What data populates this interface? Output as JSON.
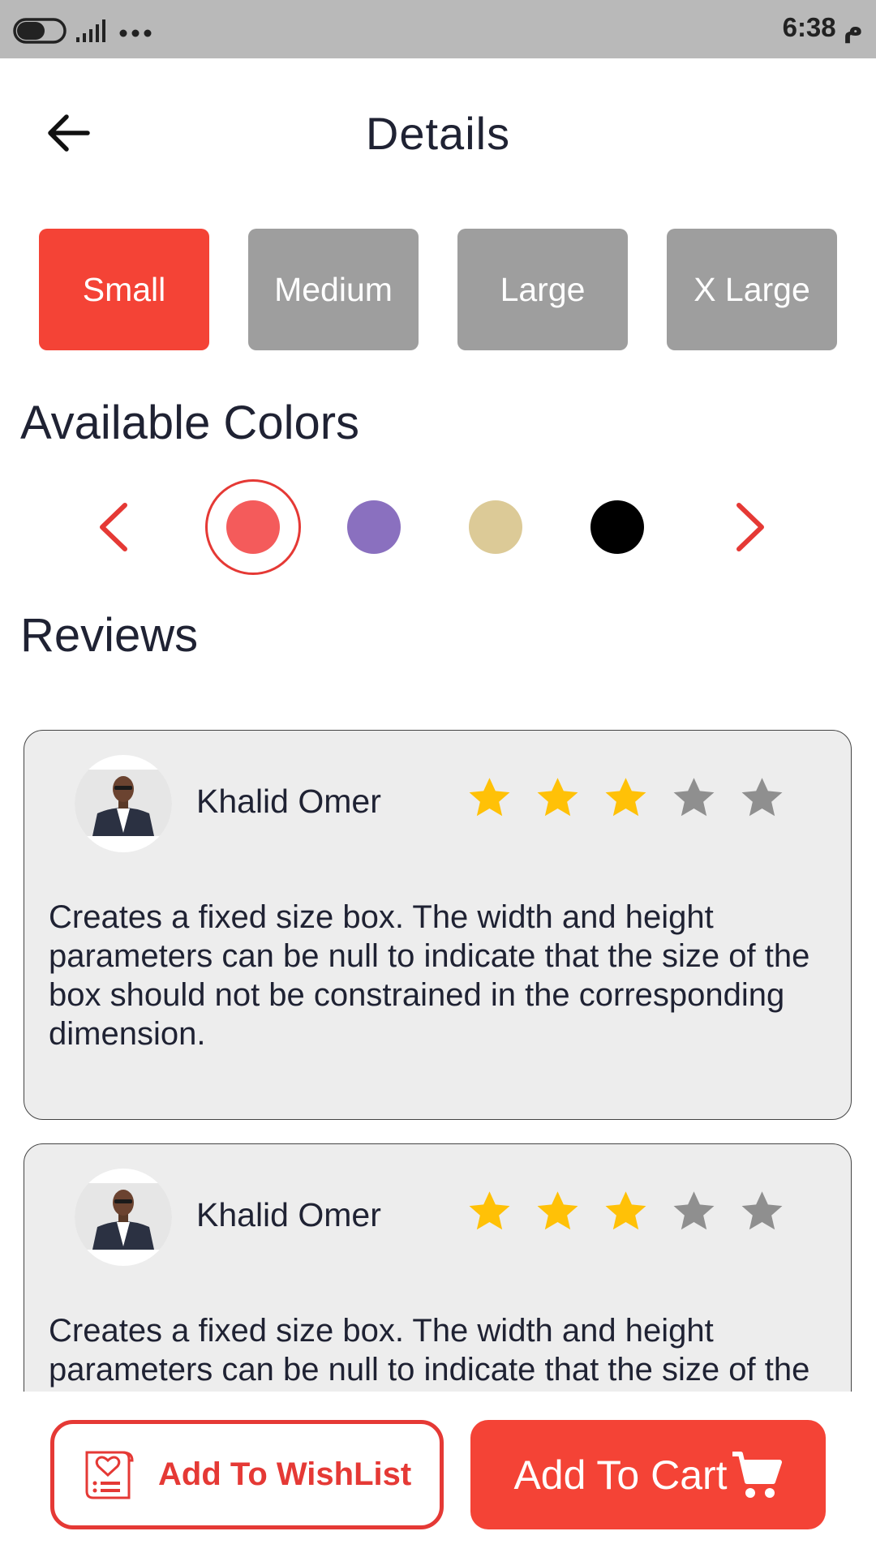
{
  "status_bar": {
    "time": "6:38 م",
    "icons": [
      "toggle-icon",
      "signal-icon",
      "more-dots-icon"
    ]
  },
  "header": {
    "title": "Details",
    "back_icon": "arrow-left-icon"
  },
  "sizes": {
    "options": [
      "Small",
      "Medium",
      "Large",
      "X Large"
    ],
    "selected": "Small"
  },
  "colors_section": {
    "title": "Available Colors",
    "swatches": [
      "#f45b5b",
      "#8a70bf",
      "#dcca97",
      "#000000"
    ],
    "selected_index": 0,
    "prev_icon": "chevron-left-icon",
    "next_icon": "chevron-right-icon"
  },
  "reviews_section": {
    "title": "Reviews",
    "items": [
      {
        "name": "Khalid Omer",
        "rating": 3,
        "max_rating": 5,
        "text": "Creates a fixed size box. The width and height parameters can be null to indicate that the size of the box should not be constrained in the corresponding dimension."
      },
      {
        "name": "Khalid Omer",
        "rating": 3,
        "max_rating": 5,
        "text": "Creates a fixed size box. The width and height parameters can be null to indicate that the size of the box should not be constrained in the corresponding dimension."
      }
    ]
  },
  "actions": {
    "wishlist_label": "Add To WishList",
    "cart_label": "Add To Cart"
  },
  "theme": {
    "accent": "#f44336",
    "inactive": "#9e9e9e",
    "star_on": "#ffc107",
    "star_off": "#8f8f8f"
  }
}
